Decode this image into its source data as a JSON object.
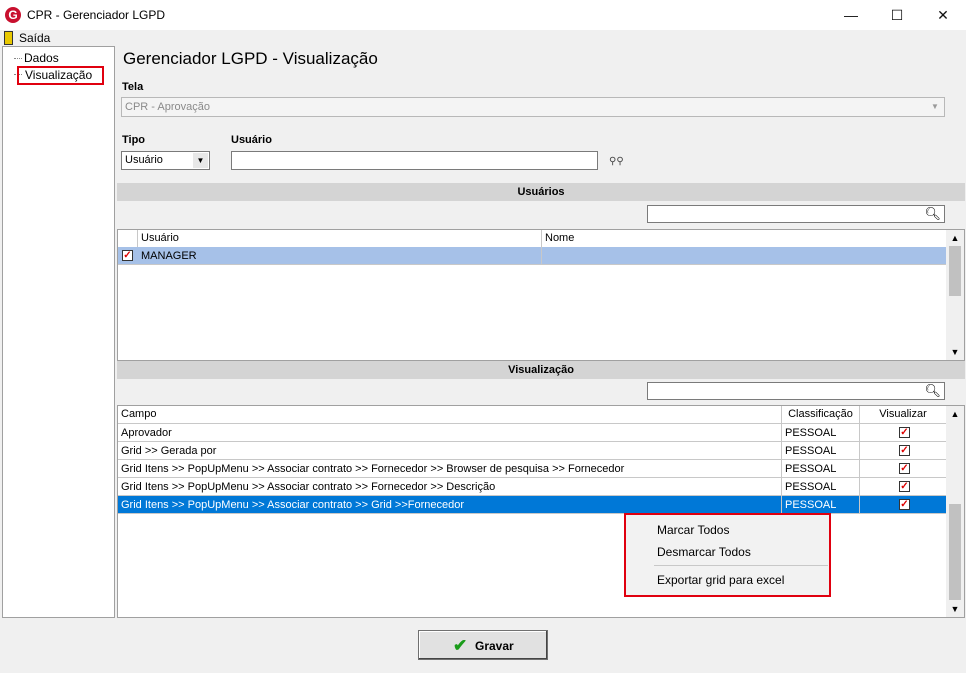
{
  "window": {
    "title": "CPR - Gerenciador LGPD",
    "logo_letter": "G",
    "minimize": "—",
    "maximize": "☐",
    "close": "✕"
  },
  "menu": {
    "exit_label": "Saída"
  },
  "tree": {
    "items": [
      {
        "label": "Dados"
      },
      {
        "label": "Visualização"
      }
    ]
  },
  "page": {
    "title": "Gerenciador LGPD - Visualização"
  },
  "form": {
    "tela_label": "Tela",
    "tela_value": "CPR - Aprovação",
    "tipo_label": "Tipo",
    "tipo_value": "Usuário",
    "usuario_label": "Usuário",
    "usuario_value": ""
  },
  "users_section": {
    "title": "Usuários",
    "search_value": "",
    "columns": [
      "Usuário",
      "Nome"
    ],
    "rows": [
      {
        "usuario": "MANAGER",
        "nome": "",
        "checked": true
      }
    ]
  },
  "view_section": {
    "title": "Visualização",
    "search_value": "",
    "columns": [
      "Campo",
      "Classificação",
      "Visualizar"
    ],
    "rows": [
      {
        "campo": "Aprovador",
        "classificacao": "PESSOAL",
        "visualizar": true
      },
      {
        "campo": "Grid >> Gerada por",
        "classificacao": "PESSOAL",
        "visualizar": true
      },
      {
        "campo": "Grid Itens >> PopUpMenu >> Associar contrato >> Fornecedor >> Browser de pesquisa >> Fornecedor",
        "classificacao": "PESSOAL",
        "visualizar": true
      },
      {
        "campo": "Grid Itens >> PopUpMenu >> Associar contrato >> Fornecedor >> Descrição",
        "classificacao": "PESSOAL",
        "visualizar": true
      },
      {
        "campo": "Grid Itens >> PopUpMenu >> Associar contrato >> Grid >>Fornecedor",
        "classificacao": "PESSOAL",
        "visualizar": true
      }
    ]
  },
  "context_menu": {
    "items": [
      "Marcar Todos",
      "Desmarcar Todos",
      "Exportar grid para excel"
    ]
  },
  "footer": {
    "save_label": "Gravar"
  },
  "colors": {
    "selection": "#0078d7",
    "user_row": "#a6c1e8",
    "highlight_border": "#e0000f"
  }
}
